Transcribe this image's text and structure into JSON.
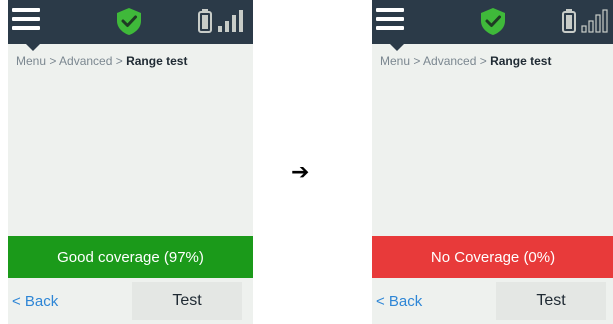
{
  "arrow_glyph": "➔",
  "screens": [
    {
      "breadcrumb": {
        "path": "Menu > Advanced > ",
        "current": "Range test"
      },
      "status": {
        "label": "Good coverage (97%)",
        "color": "#1b9a1a"
      },
      "back_label": "< Back",
      "test_label": "Test",
      "icons": [
        "menu-icon",
        "shield-check-icon",
        "battery-icon",
        "signal-strength-icon"
      ]
    },
    {
      "breadcrumb": {
        "path": "Menu > Advanced > ",
        "current": "Range test"
      },
      "status": {
        "label": "No Coverage (0%)",
        "color": "#e83a3a"
      },
      "back_label": "< Back",
      "test_label": "Test",
      "icons": [
        "menu-icon",
        "shield-check-icon",
        "battery-icon",
        "signal-strength-icon"
      ]
    }
  ]
}
